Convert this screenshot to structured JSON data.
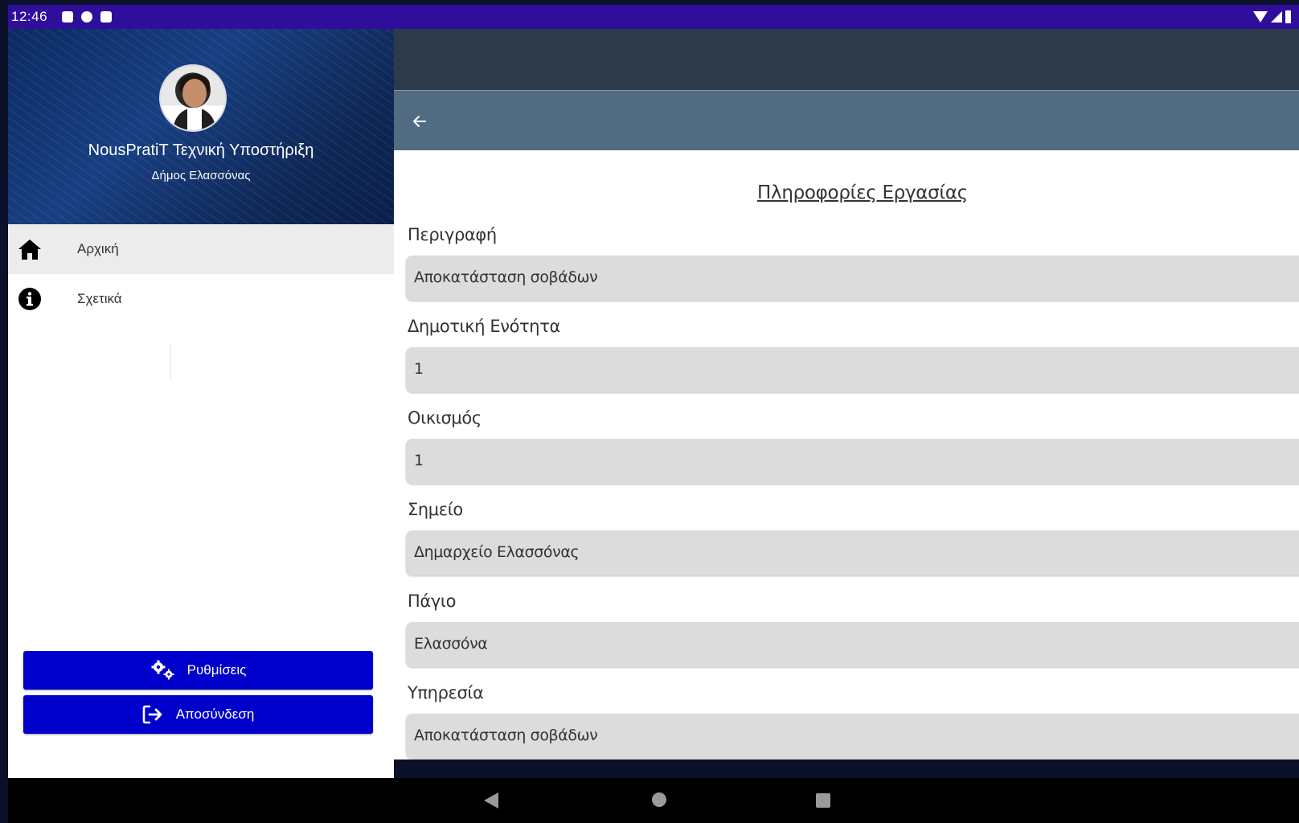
{
  "status_bar": {
    "time": "12:46"
  },
  "drawer": {
    "title": "NousPratiT Τεχνική Υποστήριξη",
    "subtitle": "Δήμος Ελασσόνας",
    "menu": [
      {
        "label": "Αρχική",
        "icon": "home-icon",
        "active": true
      },
      {
        "label": "Σχετικά",
        "icon": "info-icon",
        "active": false
      }
    ],
    "settings_label": "Ρυθμίσεις",
    "logout_label": "Αποσύνδεση"
  },
  "colors": {
    "statusbar": "#2f0e9c",
    "toolbar": "#516b82",
    "drawer_button": "#0000cc",
    "field_bg": "#dcdcdc"
  },
  "main": {
    "section_title": "Πληροφορίες Εργασίας",
    "fields": [
      {
        "label": "Περιγραφή",
        "value": "Αποκατάσταση σοβάδων"
      },
      {
        "label": "Δημοτική Ενότητα",
        "value": "1"
      },
      {
        "label": "Οικισμός",
        "value": "1"
      },
      {
        "label": "Σημείο",
        "value": "Δημαρχείο Ελασσόνας"
      },
      {
        "label": "Πάγιο",
        "value": "Ελασσόνα"
      },
      {
        "label": "Υπηρεσία",
        "value": "Αποκατάσταση σοβάδων"
      }
    ]
  }
}
